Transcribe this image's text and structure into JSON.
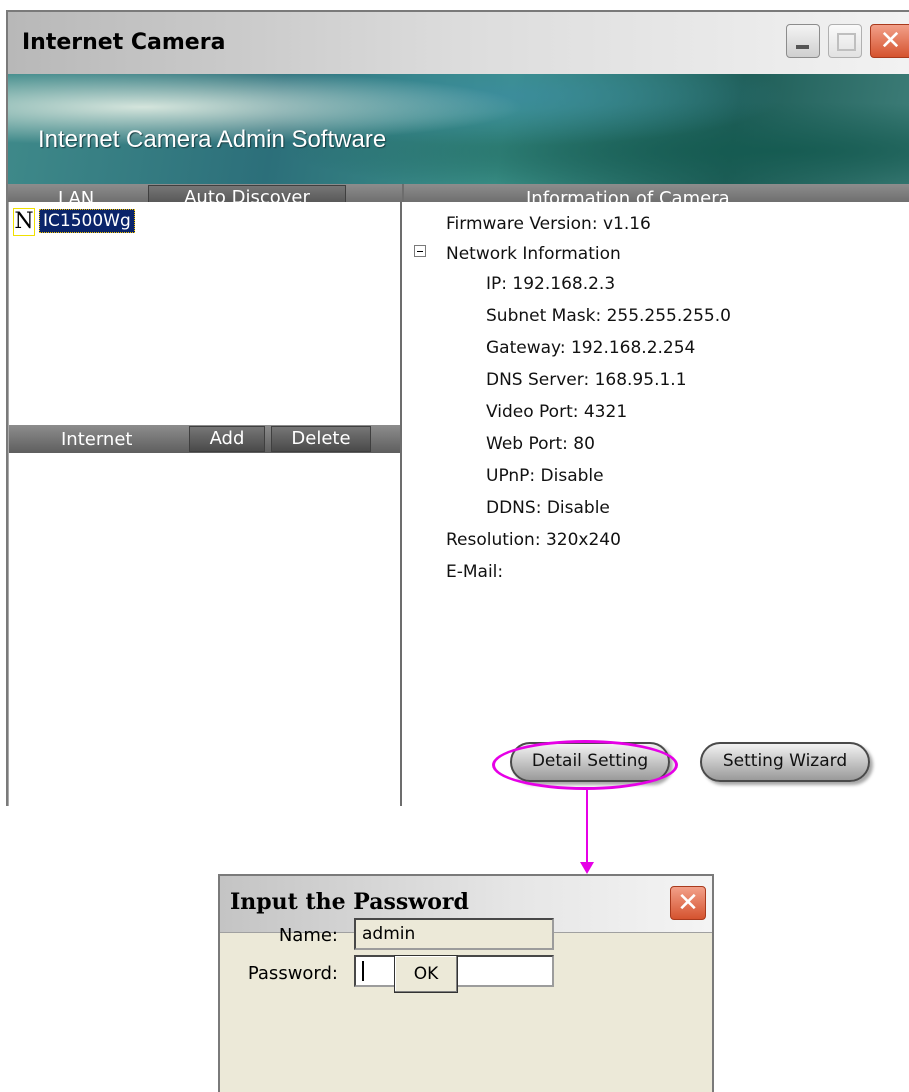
{
  "main_window": {
    "title": "Internet Camera",
    "banner_title": "Internet Camera Admin Software",
    "lan_tab": "LAN",
    "auto_discover_button": "Auto Discover",
    "info_header": "Information of Camera",
    "camera_list": [
      {
        "icon": "N",
        "label": "IC1500Wg",
        "selected": true
      }
    ],
    "internet_tab": "Internet",
    "add_button": "Add",
    "delete_button": "Delete",
    "info": {
      "firmware": "Firmware Version: v1.16",
      "network_header": "Network Information",
      "ip": "IP:  192.168.2.3",
      "subnet": "Subnet Mask:  255.255.255.0",
      "gateway": "Gateway:  192.168.2.254",
      "dns": "DNS Server:  168.95.1.1",
      "video_port": "Video Port:  4321",
      "web_port": "Web Port:  80",
      "upnp": "UPnP:  Disable",
      "ddns": "DDNS:  Disable",
      "resolution": "Resolution: 320x240",
      "email": "E-Mail:"
    },
    "detail_setting_button": "Detail Setting",
    "setting_wizard_button": "Setting Wizard"
  },
  "dialog": {
    "title": "Input the Password",
    "name_label": "Name:",
    "name_value": "admin",
    "password_label": "Password:",
    "password_value": "",
    "ok_button": "OK"
  },
  "annotation_color": "#e600e6"
}
